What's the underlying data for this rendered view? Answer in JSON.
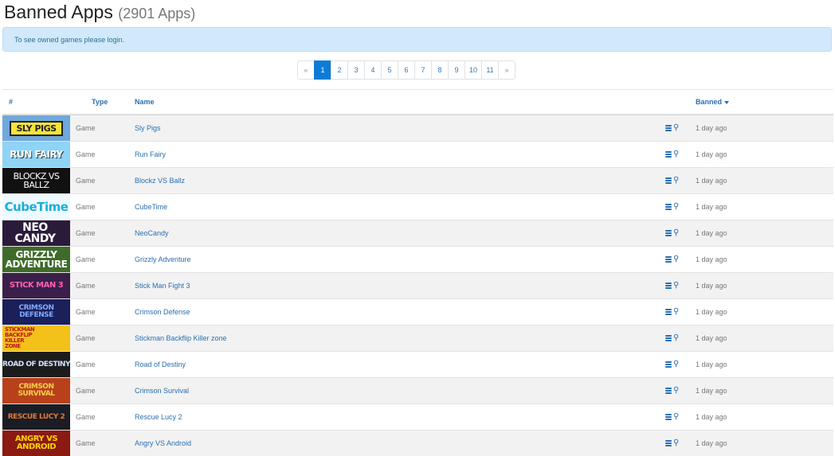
{
  "header": {
    "title": "Banned Apps",
    "count": "(2901 Apps)"
  },
  "alert": {
    "text": "To see owned games please login."
  },
  "pagination": {
    "prev": "«",
    "pages": [
      "1",
      "2",
      "3",
      "4",
      "5",
      "6",
      "7",
      "8",
      "9",
      "10",
      "11"
    ],
    "active": "1",
    "next": "»"
  },
  "table": {
    "headers": {
      "hash": "#",
      "type": "Type",
      "name": "Name",
      "banned": "Banned"
    },
    "rows": [
      {
        "thumb": "SLY PIGS",
        "type": "Game",
        "name": "Sly Pigs",
        "banned": "1 day ago"
      },
      {
        "thumb": "RUN FAIRY",
        "type": "Game",
        "name": "Run Fairy",
        "banned": "1 day ago"
      },
      {
        "thumb": "BLOCKZ VS BALLZ",
        "type": "Game",
        "name": "Blockz VS Ballz",
        "banned": "1 day ago"
      },
      {
        "thumb": "CubeTime",
        "type": "Game",
        "name": "CubeTime",
        "banned": "1 day ago"
      },
      {
        "thumb": "NEO CANDY",
        "type": "Game",
        "name": "NeoCandy",
        "banned": "1 day ago"
      },
      {
        "thumb": "GRIZZLY ADVENTURE",
        "type": "Game",
        "name": "Grizzly Adventure",
        "banned": "1 day ago"
      },
      {
        "thumb": "STICK MAN 3",
        "type": "Game",
        "name": "Stick Man Fight 3",
        "banned": "1 day ago"
      },
      {
        "thumb": "CRIMSON DEFENSE",
        "type": "Game",
        "name": "Crimson Defense",
        "banned": "1 day ago"
      },
      {
        "thumb": "STICKMAN BACKFLIP KILLER ZONE",
        "type": "Game",
        "name": "Stickman Backflip Killer zone",
        "banned": "1 day ago"
      },
      {
        "thumb": "ROAD OF DESTINY",
        "type": "Game",
        "name": "Road of Destiny",
        "banned": "1 day ago"
      },
      {
        "thumb": "CRIMSON SURVIVAL",
        "type": "Game",
        "name": "Crimson Survival",
        "banned": "1 day ago"
      },
      {
        "thumb": "RESCUE LUCY 2",
        "type": "Game",
        "name": "Rescue Lucy 2",
        "banned": "1 day ago"
      },
      {
        "thumb": "ANGRY VS ANDROID",
        "type": "Game",
        "name": "Angry VS Android",
        "banned": "1 day ago"
      }
    ]
  },
  "icons": {
    "db": "database-icon",
    "steam": "steam-icon"
  },
  "colors": {
    "link": "#2a6fb0",
    "alert_bg": "#d1e9fb",
    "active_page": "#0d7bd6"
  }
}
